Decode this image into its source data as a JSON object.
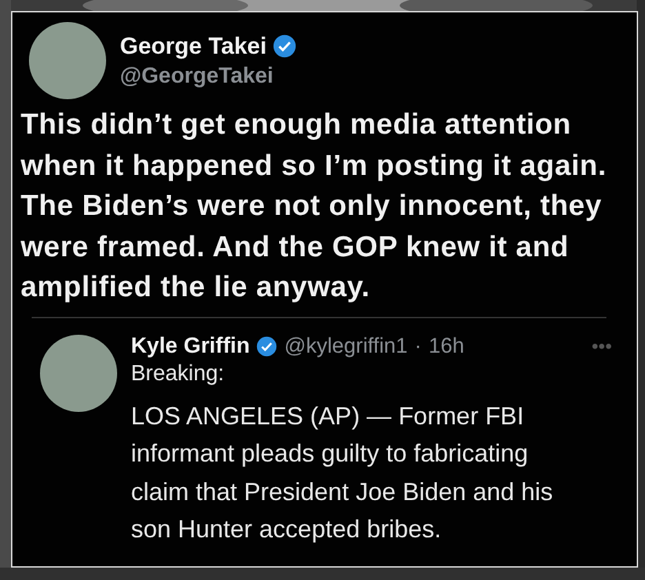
{
  "tweet": {
    "author": {
      "name": "George Takei",
      "verified": true,
      "handle": "@GeorgeTakei"
    },
    "text": "This didn’t get enough media attention when it happened so I’m posting it again. The Biden’s were not only innocent, they were framed. And the GOP knew it and amplified the lie anyway.",
    "quoted": {
      "author": {
        "name": "Kyle Griffin",
        "verified": true,
        "handle": "@kylegriffin1",
        "separator": "·",
        "time": "16h",
        "more": "•••"
      },
      "lead": "Breaking:",
      "text": "LOS ANGELES (AP) — Former FBI informant pleads guilty to fabricating claim that President Joe Biden and his son Hunter accepted bribes."
    }
  }
}
